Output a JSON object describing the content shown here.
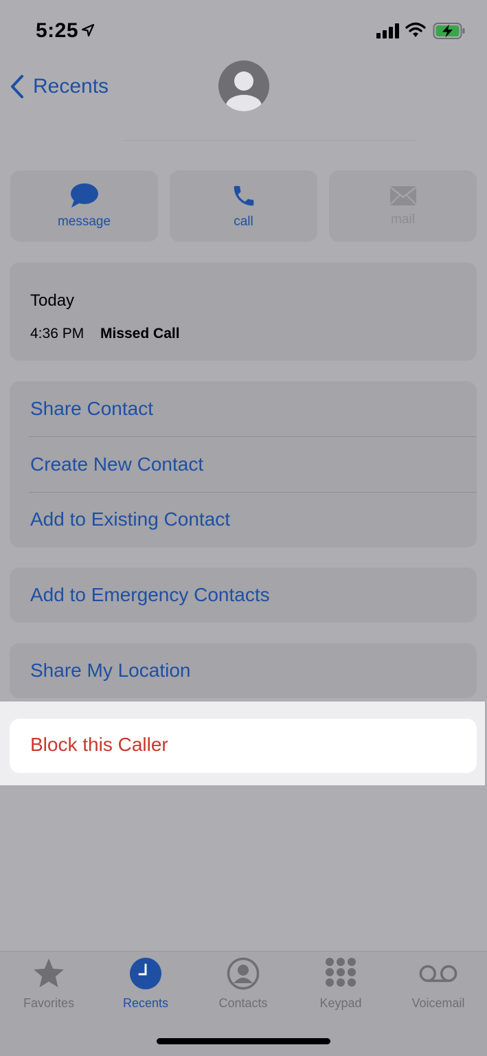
{
  "status_bar": {
    "time": "5:25"
  },
  "nav": {
    "back_label": "Recents"
  },
  "actions": [
    {
      "label": "message",
      "icon": "message-bubble-icon"
    },
    {
      "label": "call",
      "icon": "phone-icon"
    },
    {
      "label": "mail",
      "icon": "envelope-icon",
      "disabled": true
    }
  ],
  "history": {
    "day": "Today",
    "time": "4:36 PM",
    "type": "Missed Call"
  },
  "options": {
    "share_contact": "Share Contact",
    "create_new_contact": "Create New Contact",
    "add_to_existing": "Add to Existing Contact",
    "add_to_emergency": "Add to Emergency Contacts",
    "share_location": "Share My Location",
    "block_caller": "Block this Caller"
  },
  "tabs": [
    {
      "label": "Favorites",
      "icon": "star-icon"
    },
    {
      "label": "Recents",
      "icon": "clock-icon",
      "active": true
    },
    {
      "label": "Contacts",
      "icon": "person-circle-icon"
    },
    {
      "label": "Keypad",
      "icon": "keypad-icon"
    },
    {
      "label": "Voicemail",
      "icon": "voicemail-icon"
    }
  ],
  "colors": {
    "accent": "#1f4fa3",
    "destructive": "#c8382b",
    "dim_background": "#aeaeb2"
  }
}
